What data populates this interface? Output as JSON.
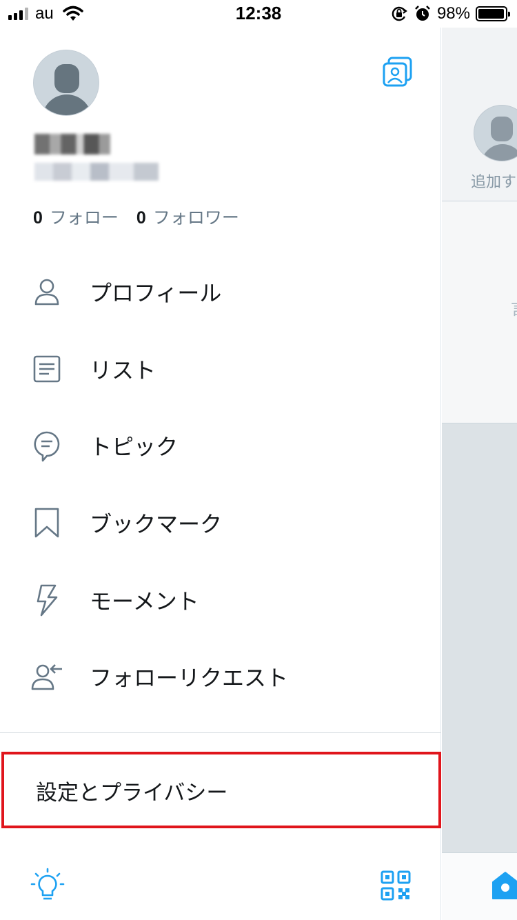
{
  "status_bar": {
    "carrier": "au",
    "time": "12:38",
    "battery_percent": "98%",
    "battery_level": 0.98,
    "icons": [
      "signal-icon",
      "wifi-icon",
      "orientation-lock-icon",
      "alarm-icon",
      "battery-icon"
    ]
  },
  "profile": {
    "following_count": "0",
    "following_label": "フォロー",
    "followers_count": "0",
    "followers_label": "フォロワー"
  },
  "menu": {
    "items": [
      {
        "label": "プロフィール",
        "icon": "profile-icon"
      },
      {
        "label": "リスト",
        "icon": "list-icon"
      },
      {
        "label": "トピック",
        "icon": "topic-icon"
      },
      {
        "label": "ブックマーク",
        "icon": "bookmark-icon"
      },
      {
        "label": "モーメント",
        "icon": "moments-icon"
      },
      {
        "label": "フォローリクエスト",
        "icon": "follow-request-icon"
      }
    ]
  },
  "settings": {
    "label": "設定とプライバシー"
  },
  "behind": {
    "add_label": "追加す",
    "partial_text": "言"
  },
  "colors": {
    "accent": "#1da1f2",
    "text": "#14171a",
    "secondary": "#657786",
    "highlight_border": "#e0151c"
  }
}
